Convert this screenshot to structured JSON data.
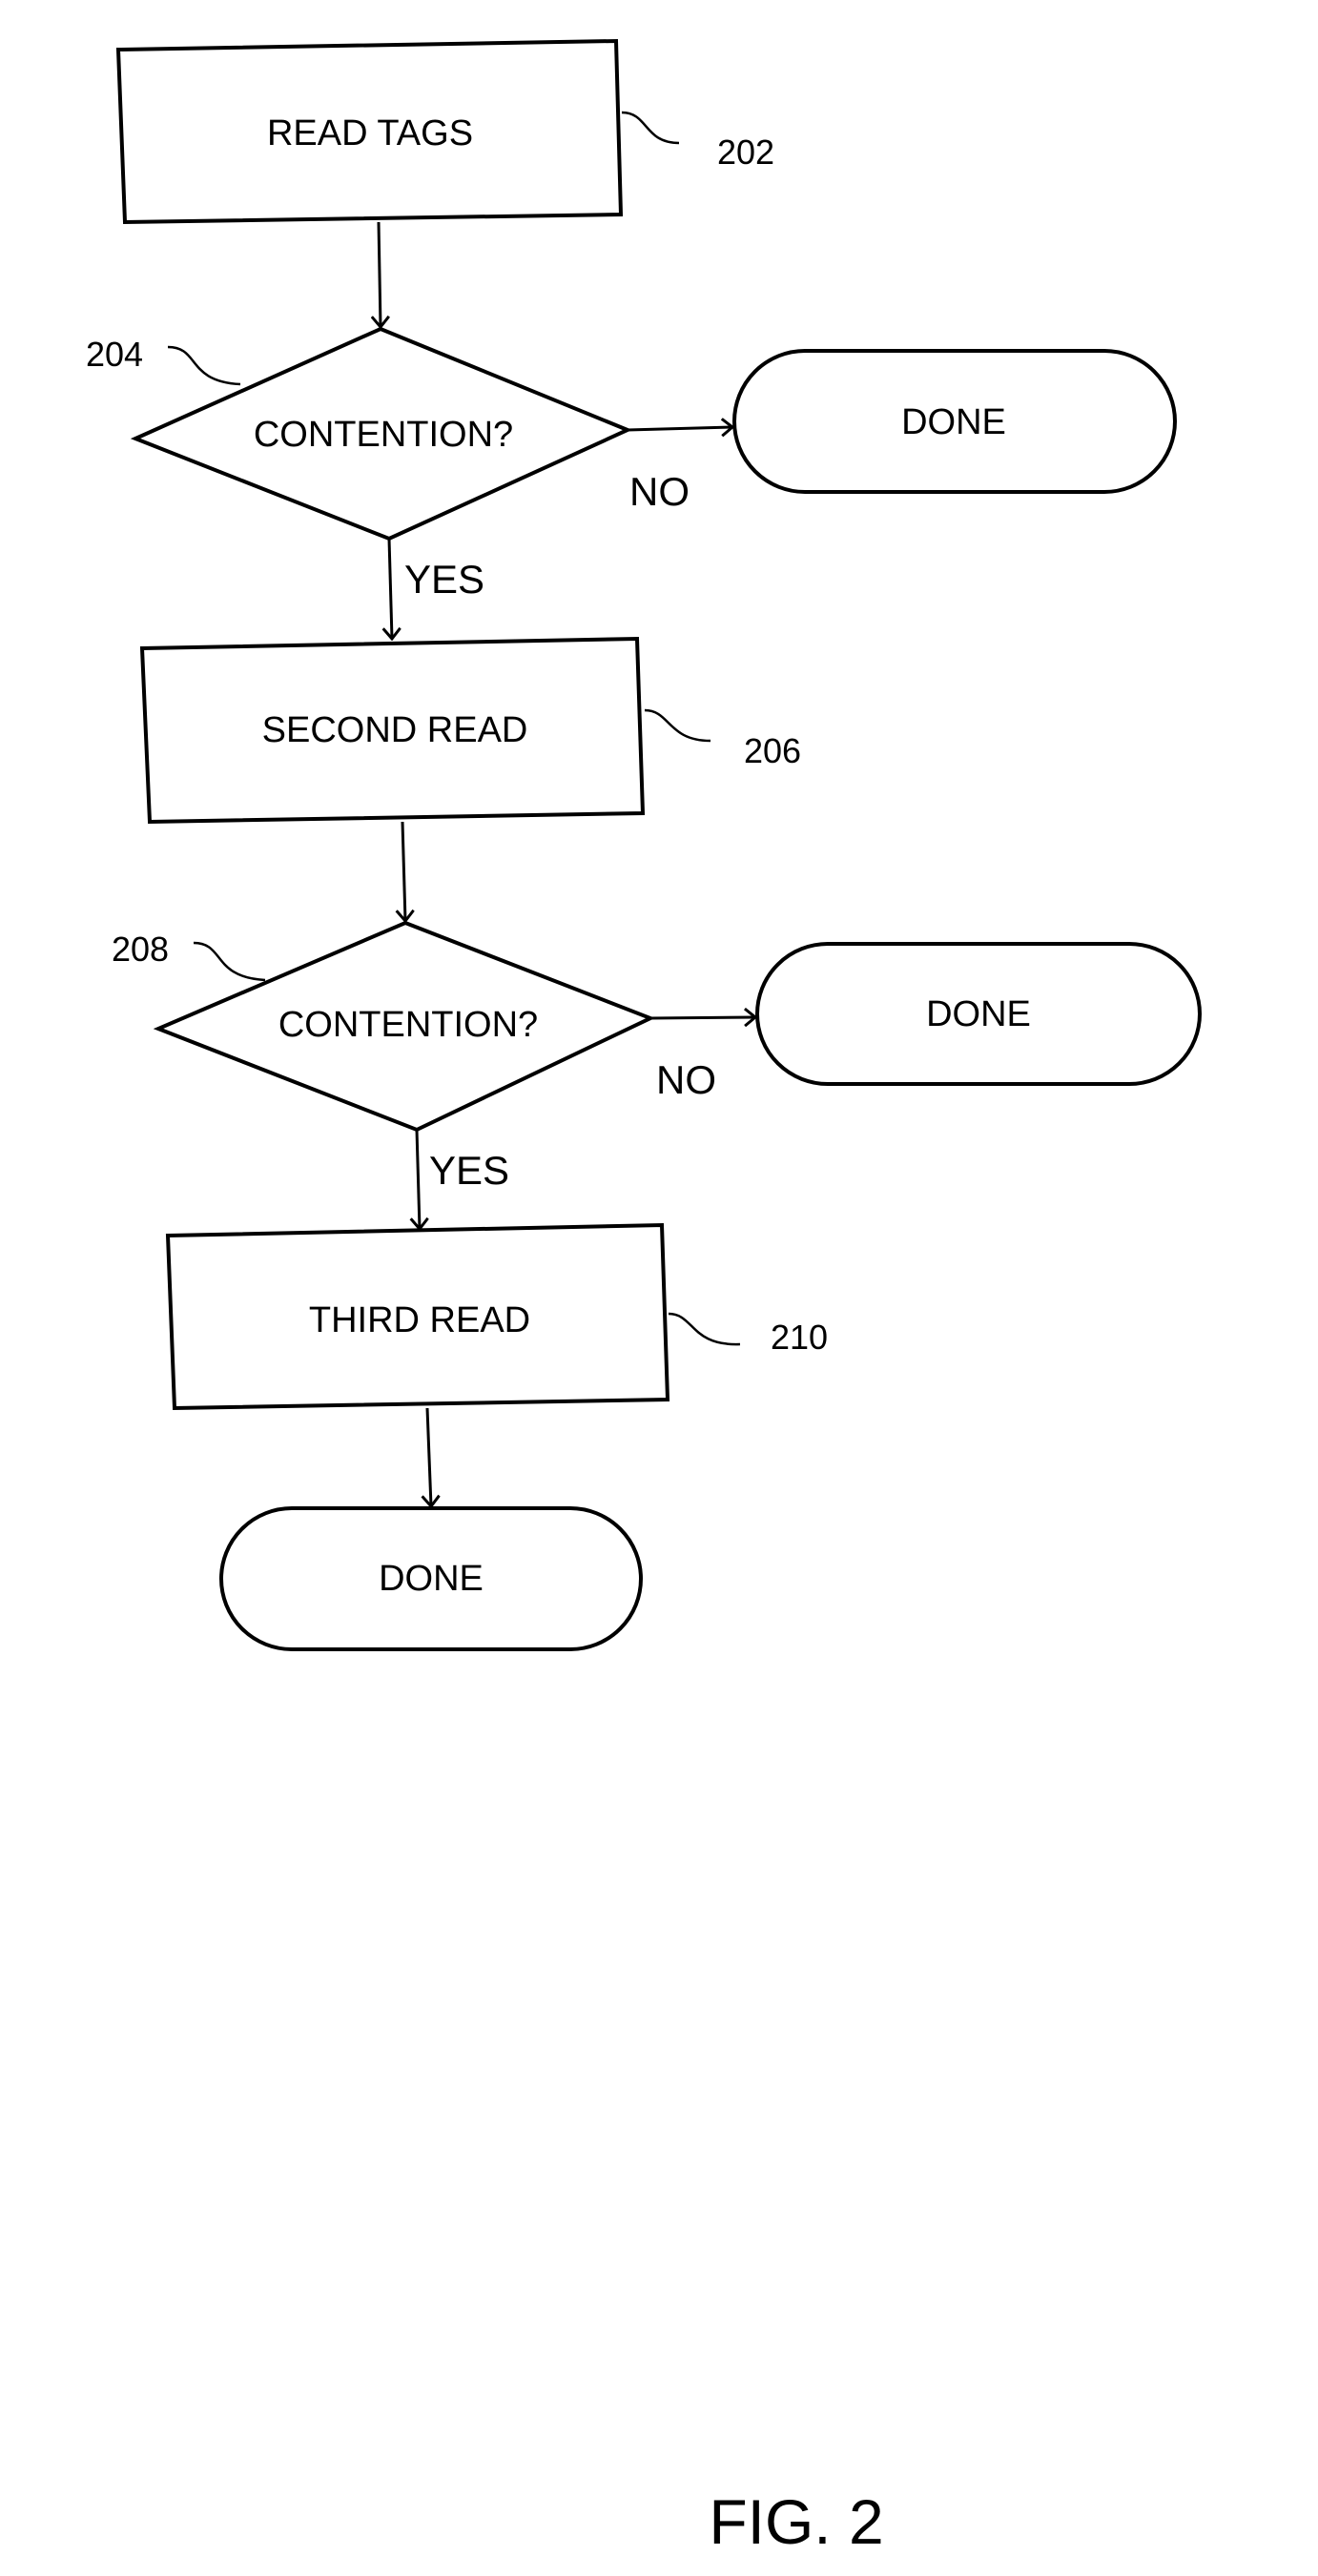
{
  "figure": {
    "caption": "FIG. 2",
    "nodes": [
      {
        "id": "202",
        "type": "process",
        "label": "READ TAGS",
        "ref": "202"
      },
      {
        "id": "204",
        "type": "decision",
        "label": "CONTENTION?",
        "ref": "204"
      },
      {
        "id": "done1",
        "type": "terminal",
        "label": "DONE"
      },
      {
        "id": "206",
        "type": "process",
        "label": "SECOND READ",
        "ref": "206"
      },
      {
        "id": "208",
        "type": "decision",
        "label": "CONTENTION?",
        "ref": "208"
      },
      {
        "id": "done2",
        "type": "terminal",
        "label": "DONE"
      },
      {
        "id": "210",
        "type": "process",
        "label": "THIRD READ",
        "ref": "210"
      },
      {
        "id": "done3",
        "type": "terminal",
        "label": "DONE"
      }
    ],
    "edges": [
      {
        "from": "202",
        "to": "204",
        "label": ""
      },
      {
        "from": "204",
        "to": "done1",
        "label": "NO"
      },
      {
        "from": "204",
        "to": "206",
        "label": "YES"
      },
      {
        "from": "206",
        "to": "208",
        "label": ""
      },
      {
        "from": "208",
        "to": "done2",
        "label": "NO"
      },
      {
        "from": "208",
        "to": "210",
        "label": "YES"
      },
      {
        "from": "210",
        "to": "done3",
        "label": ""
      }
    ]
  }
}
